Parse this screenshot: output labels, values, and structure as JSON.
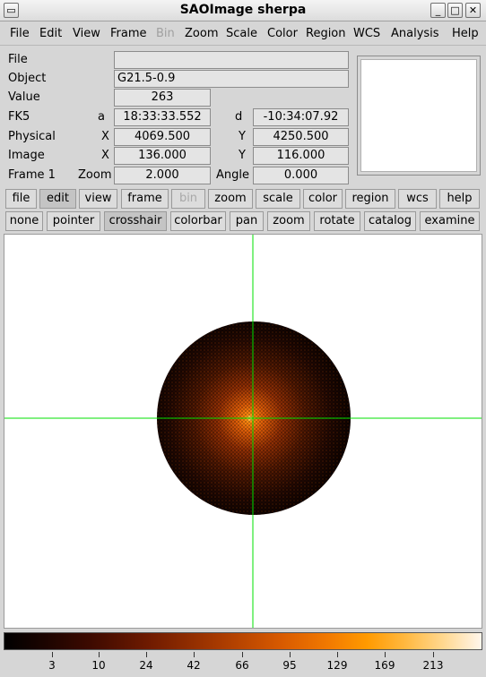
{
  "window": {
    "title": "SAOImage sherpa",
    "controls": [
      "minimize",
      "maximize",
      "close"
    ]
  },
  "menubar": [
    "File",
    "Edit",
    "View",
    "Frame",
    "Bin",
    "Zoom",
    "Scale",
    "Color",
    "Region",
    "WCS",
    "Analysis",
    "Help"
  ],
  "menubar_disabled": [
    "Bin"
  ],
  "info": {
    "file_label": "File",
    "file_value": "",
    "object_label": "Object",
    "object_value": "G21.5-0.9",
    "value_label": "Value",
    "value_value": "263",
    "fk5_label": "FK5",
    "fk5_a_label": "a",
    "fk5_a_value": "18:33:33.552",
    "fk5_d_label": "d",
    "fk5_d_value": "-10:34:07.92",
    "physical_label": "Physical",
    "physical_x_label": "X",
    "physical_x_value": "4069.500",
    "physical_y_label": "Y",
    "physical_y_value": "4250.500",
    "image_label": "Image",
    "image_x_label": "X",
    "image_x_value": "136.000",
    "image_y_label": "Y",
    "image_y_value": "116.000",
    "frame_label": "Frame 1",
    "zoom_label": "Zoom",
    "zoom_value": "2.000",
    "angle_label": "Angle",
    "angle_value": "0.000"
  },
  "buttonbar1": [
    "file",
    "edit",
    "view",
    "frame",
    "bin",
    "zoom",
    "scale",
    "color",
    "region",
    "wcs",
    "help"
  ],
  "buttonbar1_active": "edit",
  "buttonbar1_disabled": [
    "bin"
  ],
  "buttonbar2": [
    "none",
    "pointer",
    "crosshair",
    "colorbar",
    "pan",
    "zoom",
    "rotate",
    "catalog",
    "examine"
  ],
  "buttonbar2_active": "crosshair",
  "colorbar": {
    "colormap": "heat",
    "tick_labels": [
      "3",
      "10",
      "24",
      "42",
      "66",
      "95",
      "129",
      "169",
      "213"
    ]
  },
  "colors": {
    "crosshair": "#00e000",
    "background": "#d6d6d6"
  }
}
